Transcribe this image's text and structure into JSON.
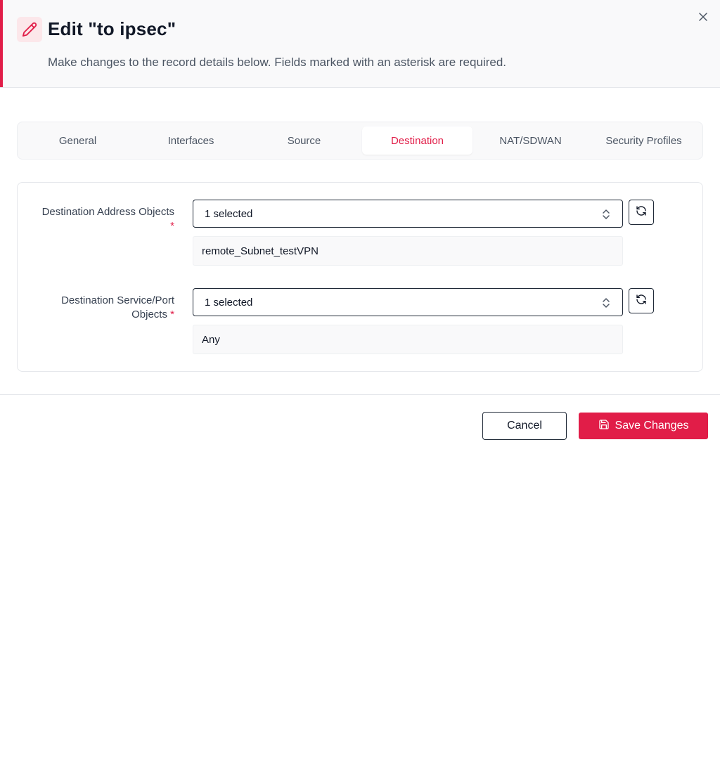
{
  "dialog": {
    "title": "Edit \"to ipsec\"",
    "subtitle": "Make changes to the record details below. Fields marked with an asterisk are required.",
    "accent_color": "#e11d48"
  },
  "tabs": [
    {
      "label": "General",
      "active": false
    },
    {
      "label": "Interfaces",
      "active": false
    },
    {
      "label": "Source",
      "active": false
    },
    {
      "label": "Destination",
      "active": true
    },
    {
      "label": "NAT/SDWAN",
      "active": false
    },
    {
      "label": "Security Profiles",
      "active": false
    }
  ],
  "fields": {
    "dest_address": {
      "label": "Destination Address Objects",
      "required_mark": "*",
      "selected_text": "1 selected",
      "chip": "remote_Subnet_testVPN"
    },
    "dest_service": {
      "label_line1": "Destination Service/Port",
      "label_line2": "Objects",
      "required_mark": "*",
      "selected_text": "1 selected",
      "chip": "Any"
    }
  },
  "footer": {
    "cancel_label": "Cancel",
    "save_label": "Save Changes"
  },
  "icons": {
    "title": "pencil-icon",
    "close": "close-icon",
    "select": "chevrons-up-down-icon",
    "refresh": "refresh-icon",
    "save": "save-icon"
  }
}
